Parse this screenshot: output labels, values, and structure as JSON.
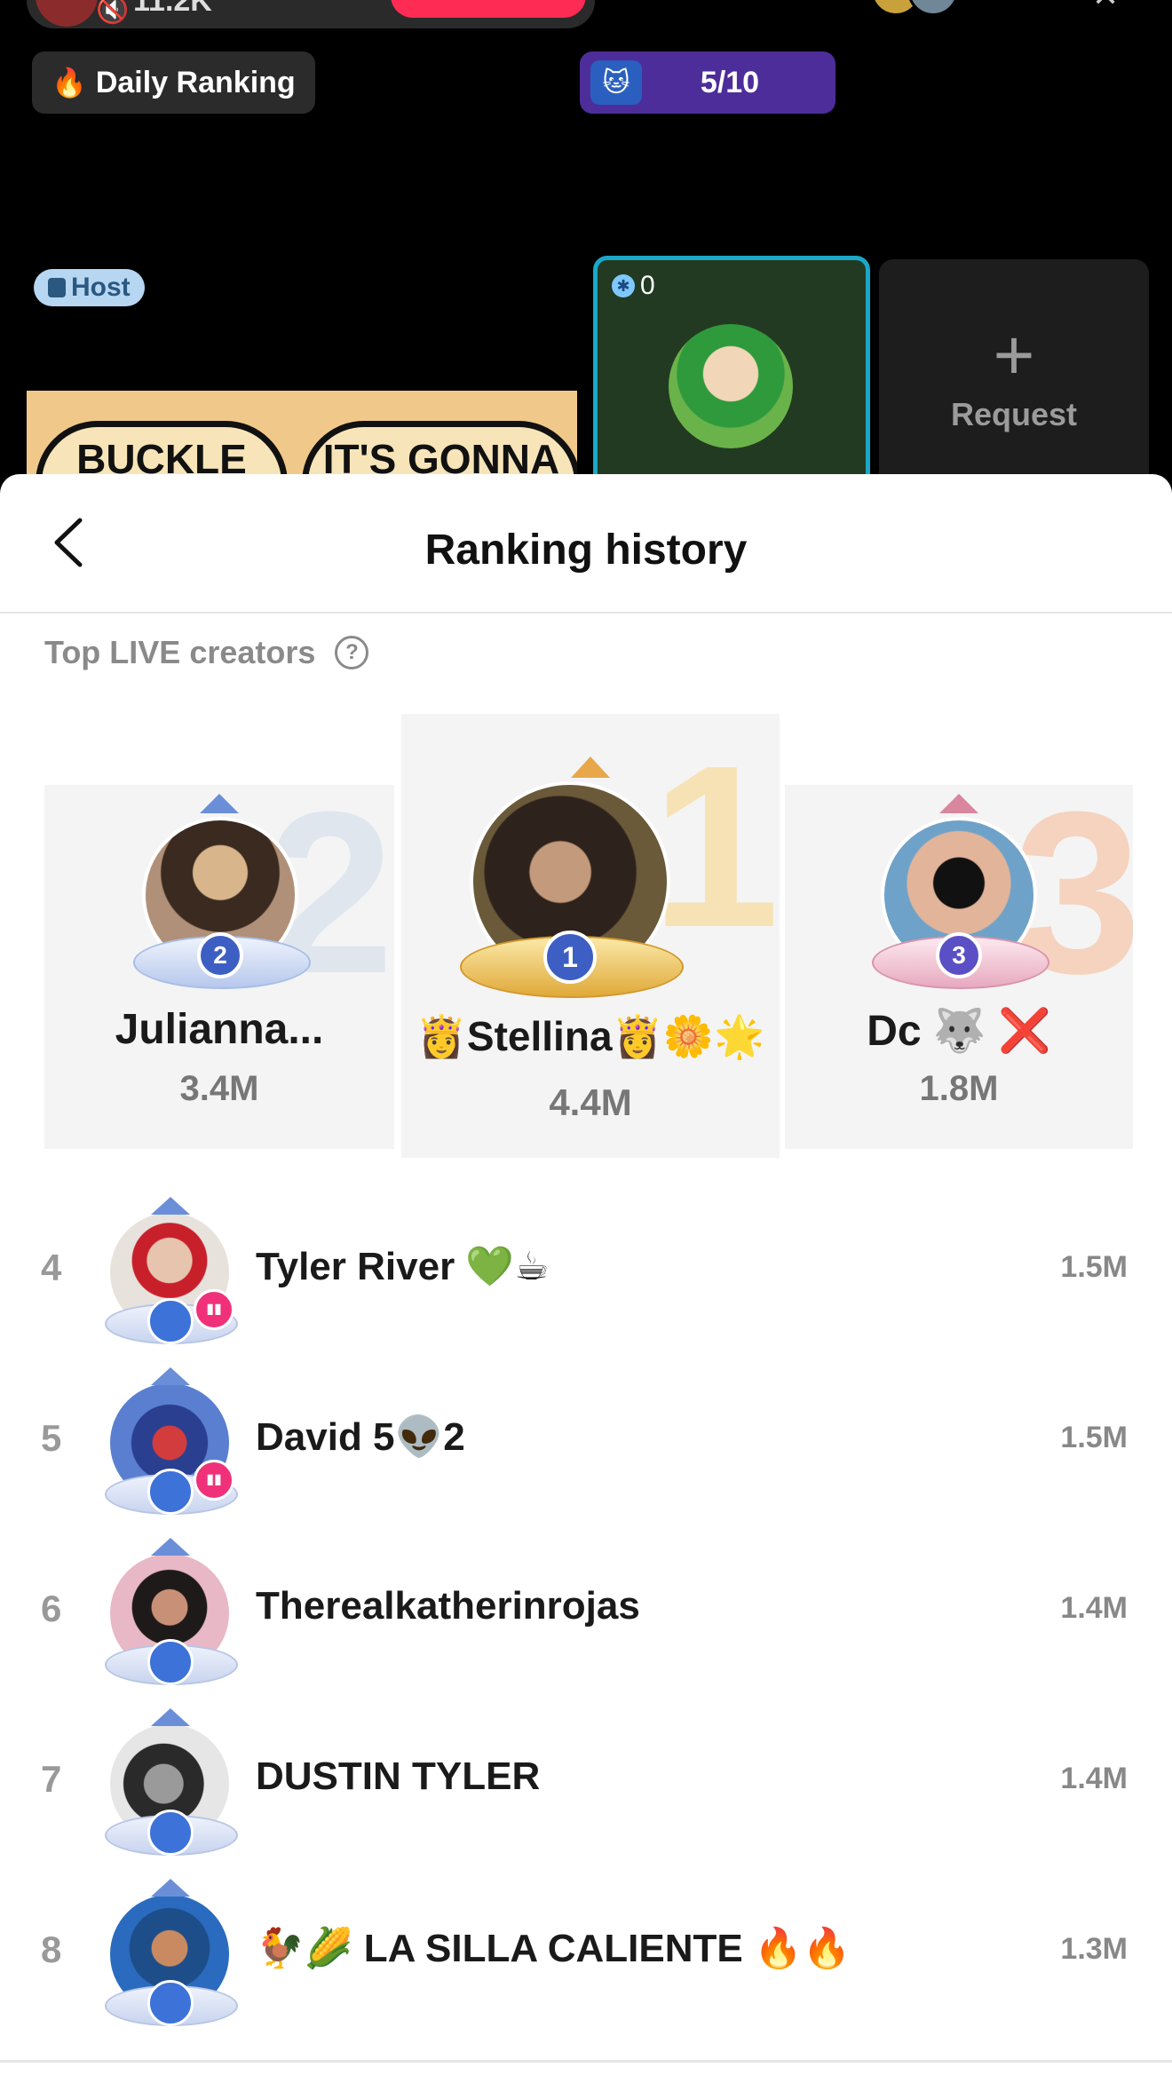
{
  "live": {
    "viewer_count": "11.2K",
    "daily_ranking_label": "Daily Ranking",
    "progress_label": "5/10",
    "host_label": "Host",
    "banner_text_1": "BUCKLE",
    "banner_text_2": "IT'S GONNA",
    "guest_score": "0",
    "request_label": "Request",
    "icons": {
      "fire": "fire-icon",
      "lock": "lock-icon",
      "plus": "plus-icon",
      "muted_mic": "muted-mic-icon"
    }
  },
  "sheet": {
    "title": "Ranking history",
    "section_label": "Top LIVE creators",
    "help_symbol": "?"
  },
  "podium": [
    {
      "rank": "2",
      "name": "Julianna...",
      "score": "3.4M",
      "color": "#dfe6ee"
    },
    {
      "rank": "1",
      "name": "👸Stellina👸🌼🌟",
      "score": "4.4M",
      "color": "#f6e2b4"
    },
    {
      "rank": "3",
      "name": "Dc 🐺 ❌",
      "score": "1.8M",
      "color": "#f5d3bf"
    }
  ],
  "list": [
    {
      "rank": "4",
      "name": "Tyler River 💚☕",
      "score": "1.5M",
      "live": true
    },
    {
      "rank": "5",
      "name": "David 5👽2",
      "score": "1.5M",
      "live": true
    },
    {
      "rank": "6",
      "name": "Therealkatherinrojas",
      "score": "1.4M",
      "live": false
    },
    {
      "rank": "7",
      "name": "DUSTIN TYLER",
      "score": "1.4M",
      "live": false
    },
    {
      "rank": "8",
      "name": "🐓🌽 LA SILLA CALIENTE 🔥🔥",
      "score": "1.3M",
      "live": false
    }
  ],
  "colors": {
    "accent_red": "#fe2c55",
    "live_pink": "#f0317a",
    "progress_purple": "#4d2d9a",
    "guest_border": "#1aa7c9",
    "host_badge": "#b7d6f2",
    "badge_blue": "#3d5fc4",
    "badge_gold": "#d9a33a",
    "badge_rose": "#c26bb0"
  }
}
